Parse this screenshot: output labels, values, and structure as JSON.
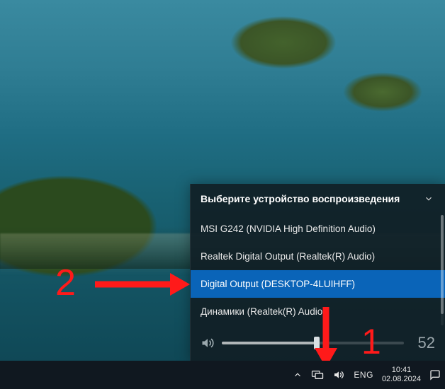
{
  "flyout": {
    "title": "Выберите устройство воспроизведения",
    "devices": [
      {
        "label": "MSI G242 (NVIDIA High Definition Audio)",
        "selected": false
      },
      {
        "label": "Realtek Digital Output (Realtek(R) Audio)",
        "selected": false
      },
      {
        "label": "Digital Output (DESKTOP-4LUIHFF)",
        "selected": true
      },
      {
        "label": "Динамики (Realtek(R) Audio)",
        "selected": false
      }
    ],
    "volume": {
      "value": "52",
      "percent": 52
    }
  },
  "taskbar": {
    "language": "ENG",
    "clock": {
      "time": "10:41",
      "date": "02.08.2024"
    }
  },
  "annotations": {
    "label1": "1",
    "label2": "2"
  }
}
